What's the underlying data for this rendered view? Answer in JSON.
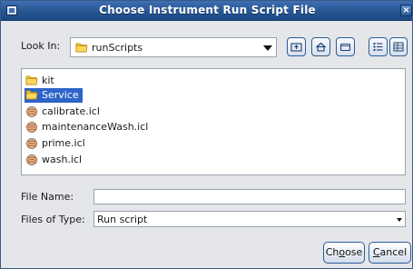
{
  "window": {
    "title": "Choose Instrument Run Script File"
  },
  "look_in": {
    "label": "Look In:",
    "value": "runScripts",
    "value_icon": "folder-icon"
  },
  "toolbar": {
    "buttons": [
      {
        "name": "up-one-level",
        "icon": "folder-up-icon"
      },
      {
        "name": "home",
        "icon": "home-icon"
      },
      {
        "name": "create-new-folder",
        "icon": "new-folder-icon"
      },
      {
        "name": "list-view",
        "icon": "list-view-icon"
      },
      {
        "name": "details-view",
        "icon": "details-view-icon"
      }
    ]
  },
  "files": [
    {
      "name": "kit",
      "icon": "folder-icon",
      "selected": false
    },
    {
      "name": "Service",
      "icon": "folder-icon",
      "selected": true
    },
    {
      "name": "calibrate.icl",
      "icon": "script-file-icon",
      "selected": false
    },
    {
      "name": "maintenanceWash.icl",
      "icon": "script-file-icon",
      "selected": false
    },
    {
      "name": "prime.icl",
      "icon": "script-file-icon",
      "selected": false
    },
    {
      "name": "wash.icl",
      "icon": "script-file-icon",
      "selected": false
    }
  ],
  "file_name": {
    "label": "File Name:",
    "value": ""
  },
  "file_type": {
    "label": "Files of Type:",
    "value": "Run script"
  },
  "buttons": {
    "choose": {
      "pre": "Ch",
      "mnemonic": "o",
      "post": "ose"
    },
    "cancel": {
      "pre": "",
      "mnemonic": "C",
      "post": "ancel"
    }
  },
  "colors": {
    "titlebar": "#24538f",
    "selection": "#2d64c8",
    "accent_border": "#2b5d98"
  }
}
